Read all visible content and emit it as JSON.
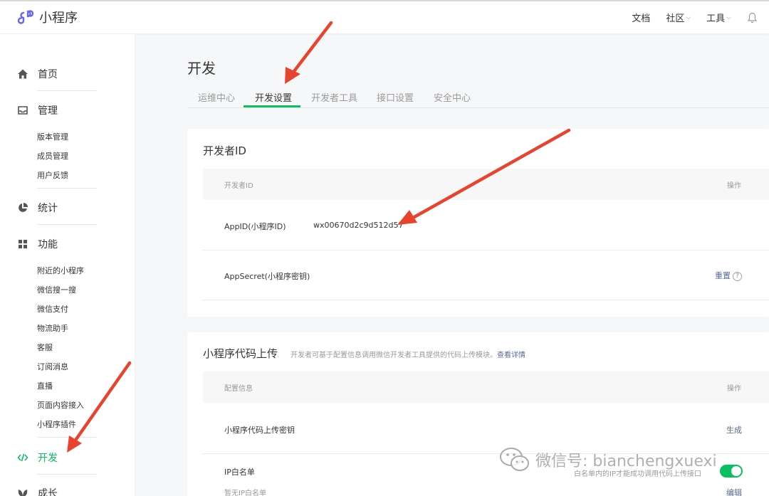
{
  "app": {
    "name": "小程序"
  },
  "topnav": {
    "docs": "文档",
    "community": "社区",
    "tools": "工具"
  },
  "sidebar": {
    "home": "首页",
    "manage": "管理",
    "manage_items": [
      "版本管理",
      "成员管理",
      "用户反馈"
    ],
    "stats": "统计",
    "features": "功能",
    "feature_items": [
      "附近的小程序",
      "微信搜一搜",
      "微信支付",
      "物流助手",
      "客服",
      "订阅消息",
      "直播",
      "页面内容接入",
      "小程序插件"
    ],
    "dev": "开发",
    "growth": "成长"
  },
  "main": {
    "title": "开发",
    "tabs": [
      "运维中心",
      "开发设置",
      "开发者工具",
      "接口设置",
      "安全中心"
    ],
    "active_tab": "开发设置"
  },
  "dev_id_card": {
    "title": "开发者ID",
    "col_name": "开发者ID",
    "col_action": "操作",
    "appid_label": "AppID(小程序ID)",
    "appid_value": "wx00670d2c9d512d57",
    "secret_label": "AppSecret(小程序密钥)",
    "secret_action": "重置",
    "help_glyph": "?"
  },
  "upload_card": {
    "title": "小程序代码上传",
    "desc": "开发者可基于配置信息调用微信开发者工具提供的代码上传模块。",
    "desc_link": "查看详情",
    "col_name": "配置信息",
    "col_action": "操作",
    "key_label": "小程序代码上传密钥",
    "key_action": "生成",
    "ip_label": "IP白名单",
    "ip_empty": "暂无IP白名单",
    "ip_hint": "白名单内的IP才能成功调用代码上传接口",
    "ip_action": "编辑",
    "ip_enabled": true
  },
  "watermark": {
    "text": "微信号: bianchengxuexi"
  },
  "colors": {
    "accent": "#07c160",
    "link": "#576b95",
    "arrow": "#e8432d"
  }
}
